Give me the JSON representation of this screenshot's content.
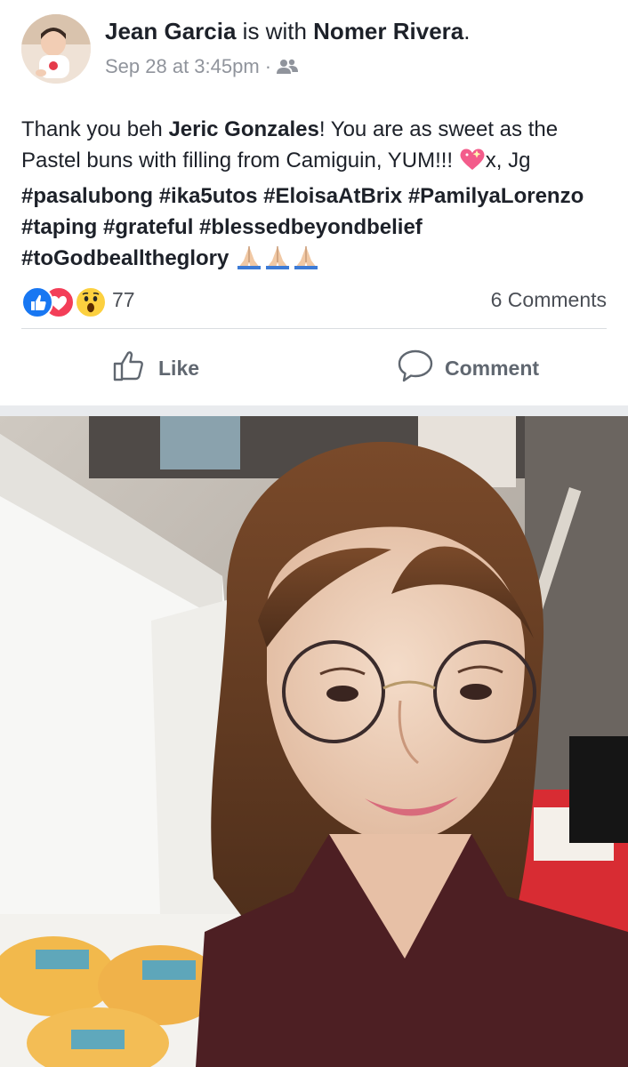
{
  "post": {
    "author": "Jean Garcia",
    "with_text": "is with",
    "tagged": "Nomer Rivera",
    "tagged_suffix": ".",
    "timestamp": "Sep 28 at 3:45pm",
    "separator": "·",
    "audience_icon": "friends-icon"
  },
  "body": {
    "t1": "Thank you beh ",
    "mention": "Jeric Gonzales",
    "t2": "! You are as sweet as the Pastel buns with filling from Camiguin, YUM!!! ",
    "t3": "x, Jg ",
    "tags_line1": [
      "#pasalubong",
      "#ika5utos",
      "#EloisaAtBrix"
    ],
    "tags_line2": [
      "#PamilyaLorenzo",
      "#taping",
      "#grateful"
    ],
    "tags_line3": [
      "#blessedbeyondbelief",
      "#toGodbealltheglory"
    ],
    "emojis": [
      "sparkling-heart-emoji",
      "folded-hands-emoji",
      "folded-hands-emoji",
      "folded-hands-emoji"
    ]
  },
  "reactions": {
    "types": [
      "like-reaction-icon",
      "love-reaction-icon",
      "wow-reaction-icon"
    ],
    "count": "77",
    "comments": "6 Comments"
  },
  "actions": {
    "like_label": "Like",
    "comment_label": "Comment"
  },
  "colors": {
    "like_blue": "#1877f2",
    "love_red": "#f33e58",
    "wow_yellow": "#fcd03f",
    "meta_gray": "#90949c"
  },
  "photo": {
    "subject": "selfie-photo"
  }
}
